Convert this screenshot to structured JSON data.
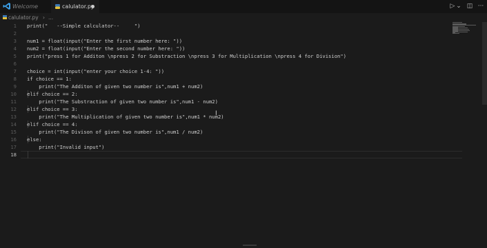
{
  "tabs": {
    "welcome": "Welcome",
    "active_file": "calulator.py",
    "active_icon": "python-icon",
    "modified_icon": "unsaved-dot-icon"
  },
  "toolbar": {
    "run_icon": "▷",
    "run_menu_icon": "⌄",
    "split_icon": "◫",
    "more_icon": "···"
  },
  "breadcrumb": {
    "file": "calulator.py",
    "separator": "›",
    "dots": "..."
  },
  "editor": {
    "current_line": 18,
    "lines": [
      {
        "n": "1",
        "text": "print(\"   --Simple calculator--     \")"
      },
      {
        "n": "2",
        "text": ""
      },
      {
        "n": "3",
        "text": "num1 = float(input(\"Enter the first number here: \"))"
      },
      {
        "n": "4",
        "text": "num2 = float(input(\"Enter the second number here: \"))"
      },
      {
        "n": "5",
        "text": "print(\"press 1 for Additon \\npress 2 for Substraction \\npress 3 for Multiplication \\npress 4 for Division\")"
      },
      {
        "n": "6",
        "text": ""
      },
      {
        "n": "7",
        "text": "choice = int(input(\"enter your choice 1-4: \"))"
      },
      {
        "n": "8",
        "text": "if choice == 1:"
      },
      {
        "n": "9",
        "text": "    print(\"The Additon of given two number is\",num1 + num2)"
      },
      {
        "n": "10",
        "text": "elif choice == 2:"
      },
      {
        "n": "11",
        "text": "    print(\"The Substraction of given two number is\",num1 - num2)"
      },
      {
        "n": "12",
        "text": "elif choice == 3:"
      },
      {
        "n": "13",
        "text": "    print(\"The Multiplication of given two number is\",num1 * num2)"
      },
      {
        "n": "14",
        "text": "elif choice == 4:"
      },
      {
        "n": "15",
        "text": "    print(\"The Divison of given two number is\",num1 / num2)"
      },
      {
        "n": "16",
        "text": "else:"
      },
      {
        "n": "17",
        "text": "    print(\"Invalid input\")"
      },
      {
        "n": "18",
        "text": ""
      }
    ]
  },
  "mouse_cursor": "I"
}
